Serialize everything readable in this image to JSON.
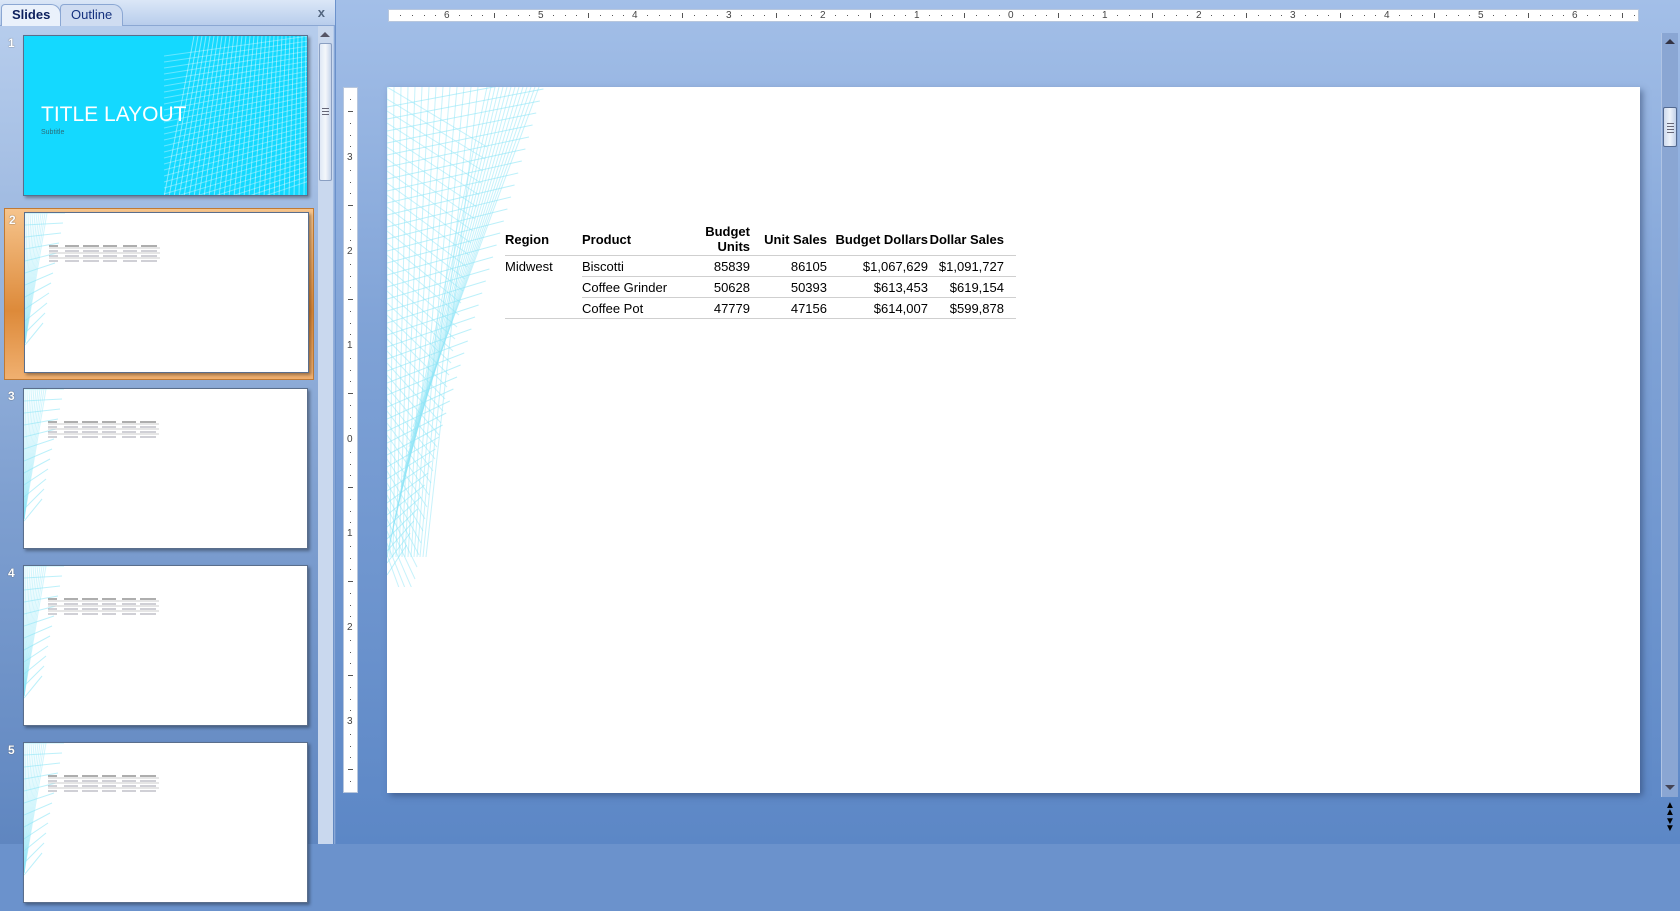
{
  "panel": {
    "tabs": [
      "Slides",
      "Outline"
    ],
    "close": "x"
  },
  "slides": [
    {
      "number": "1",
      "title": "TITLE LAYOUT",
      "subtitle": "Subtitle"
    },
    {
      "number": "2"
    },
    {
      "number": "3"
    },
    {
      "number": "4"
    },
    {
      "number": "5"
    }
  ],
  "selected_slide": 2,
  "ruler": {
    "h": [
      "6",
      "5",
      "4",
      "3",
      "2",
      "1",
      "0",
      "1",
      "2",
      "3",
      "4",
      "5",
      "6"
    ],
    "v": [
      "3",
      "2",
      "1",
      "0",
      "1",
      "2",
      "3"
    ]
  },
  "table": {
    "headers": [
      "Region",
      "Product",
      "Budget Units",
      "Unit Sales",
      "Budget Dollars",
      "Dollar Sales"
    ],
    "region": "Midwest",
    "rows": [
      [
        "Biscotti",
        "85839",
        "86105",
        "$1,067,629",
        "$1,091,727"
      ],
      [
        "Coffee Grinder",
        "50628",
        "50393",
        "$613,453",
        "$619,154"
      ],
      [
        "Coffee Pot",
        "47779",
        "47156",
        "$614,007",
        "$599,878"
      ]
    ]
  },
  "colors": {
    "title_slide_bg": "#14d9ff",
    "wireframe": "#8fe6f7",
    "selection": "#e8963f"
  }
}
